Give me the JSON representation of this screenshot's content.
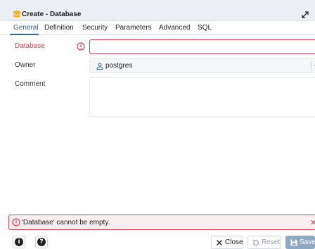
{
  "window": {
    "title": "Create - Database"
  },
  "tabs": [
    "General",
    "Definition",
    "Security",
    "Parameters",
    "Advanced",
    "SQL"
  ],
  "active_tab": "General",
  "form": {
    "database_label": "Database",
    "database_value": "",
    "owner_label": "Owner",
    "owner_value": "postgres",
    "comment_label": "Comment",
    "comment_value": ""
  },
  "error": {
    "message": "'Database' cannot be empty."
  },
  "footer": {
    "close_label": "Close",
    "reset_label": "Reset",
    "save_label": "Save"
  },
  "icons": {
    "title": "database-icon",
    "expand": "maximize-icon",
    "error": "alert-circle-icon",
    "owner": "user-icon",
    "info": "info-icon",
    "help": "help-icon",
    "close": "x-icon",
    "reset": "reset-icon",
    "save": "floppy-icon"
  },
  "colors": {
    "accent": "#326690",
    "error": "#ce4153",
    "error_bg": "#fbeef0",
    "save_disabled": "#8fa9c3",
    "db_icon": "#f0b323"
  }
}
